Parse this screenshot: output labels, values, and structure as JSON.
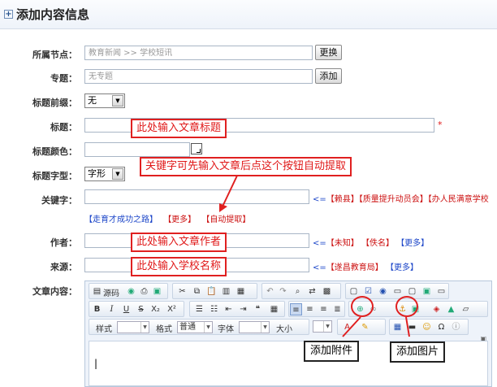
{
  "header": {
    "icon": "expand-icon",
    "title": "添加内容信息"
  },
  "form": {
    "node_label": "所属节点：",
    "node_value": "教育新闻 >> 学校短讯",
    "change_button": "更换",
    "topic_label": "专题：",
    "topic_value": "无专题",
    "add_button": "添加",
    "prefix_label": "标题前缀：",
    "prefix_value": "无",
    "title_label": "标题：",
    "required_mark": "*",
    "title_color_label": "标题颜色：",
    "title_font_label": "标题字型：",
    "title_font_value": "字形",
    "keyword_label": "关键字：",
    "keyword_prefix": "<=",
    "keyword_suggestions": [
      "【赖县】",
      "【质量提升动员会】",
      "【办人民满意学校"
    ],
    "keyword_row2_link": "【走育才成功之路】",
    "keyword_more": "【更多】",
    "keyword_auto": "【自动提取】",
    "author_label": "作者：",
    "author_prefix": "<=",
    "author_options": [
      "【未知】",
      "【佚名】",
      "【更多】"
    ],
    "source_label": "来源：",
    "source_prefix": "<=",
    "source_options": [
      "【遂昌教育局】",
      "【更多】"
    ],
    "content_label": "文章内容："
  },
  "callouts": {
    "title_hint": "此处输入文章标题",
    "keyword_hint": "关键字可先输入文章后点这个按钮自动提取",
    "author_hint": "此处输入文章作者",
    "source_hint": "此处输入学校名称",
    "attach_hint": "添加附件",
    "image_hint": "添加图片"
  },
  "editor": {
    "source_label": "源码",
    "style_label": "样式",
    "format_label": "格式",
    "format_value": "普通",
    "font_label": "字体",
    "size_label": "大小",
    "cursor": "|",
    "bold": "B",
    "italic": "I",
    "underline": "U",
    "strike": "S",
    "subscript": "X₂",
    "superscript": "X²"
  },
  "colors": {
    "callout_border": "#e02020",
    "link_blue": "#1a44c8",
    "link_red": "#cc1111"
  }
}
